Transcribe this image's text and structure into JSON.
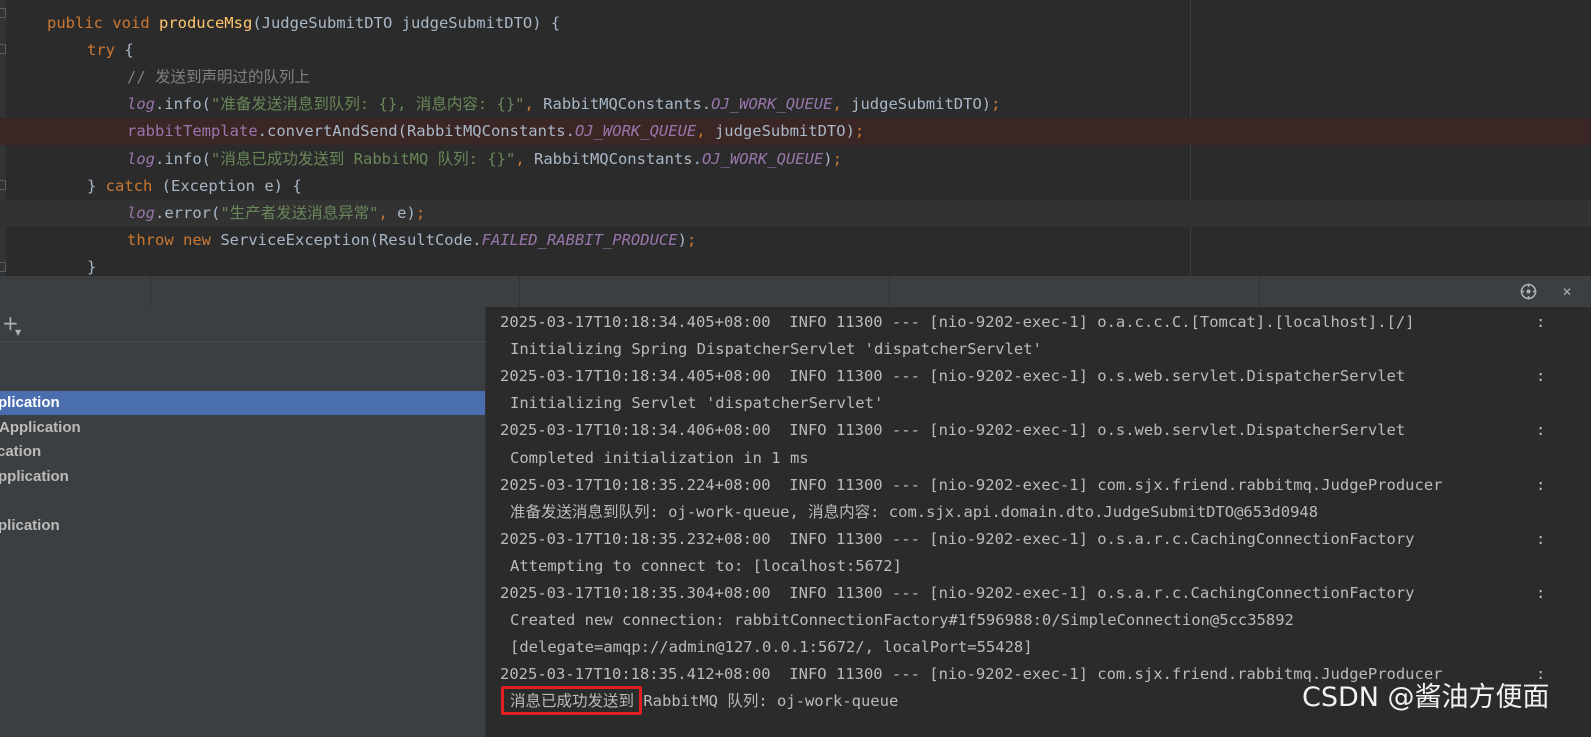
{
  "editor": {
    "lines": [
      [
        {
          "c": "kw",
          "t": "public void "
        },
        {
          "c": "fn",
          "t": "produceMsg"
        },
        {
          "c": "",
          "t": "(JudgeSubmitDTO judgeSubmitDTO) {"
        }
      ],
      [
        {
          "c": "kw",
          "t": "try "
        },
        {
          "c": "",
          "t": "{"
        }
      ],
      [
        {
          "c": "cm",
          "t": "// 发送到声明过的队列上"
        }
      ],
      [
        {
          "c": "sf",
          "t": "log"
        },
        {
          "c": "",
          "t": ".info("
        },
        {
          "c": "st",
          "t": "\"准备发送消息到队列: {}, 消息内容: {}\""
        },
        {
          "c": "kw",
          "t": ", "
        },
        {
          "c": "",
          "t": "RabbitMQConstants."
        },
        {
          "c": "sf",
          "t": "OJ_WORK_QUEUE"
        },
        {
          "c": "kw",
          "t": ", "
        },
        {
          "c": "",
          "t": "judgeSubmitDTO)"
        },
        {
          "c": "kw",
          "t": ";"
        }
      ],
      [
        {
          "c": "fd",
          "t": "rabbitTemplate"
        },
        {
          "c": "",
          "t": ".convertAndSend(RabbitMQConstants."
        },
        {
          "c": "sf",
          "t": "OJ_WORK_QUEUE"
        },
        {
          "c": "kw",
          "t": ", "
        },
        {
          "c": "",
          "t": "judgeSubmitDTO)"
        },
        {
          "c": "kw",
          "t": ";"
        }
      ],
      [
        {
          "c": "sf",
          "t": "log"
        },
        {
          "c": "",
          "t": ".info("
        },
        {
          "c": "st",
          "t": "\"消息已成功发送到 RabbitMQ 队列: {}\""
        },
        {
          "c": "kw",
          "t": ", "
        },
        {
          "c": "",
          "t": "RabbitMQConstants."
        },
        {
          "c": "sf",
          "t": "OJ_WORK_QUEUE"
        },
        {
          "c": "",
          "t": ")"
        },
        {
          "c": "kw",
          "t": ";"
        }
      ],
      [
        {
          "c": "",
          "t": "} "
        },
        {
          "c": "kw",
          "t": "catch "
        },
        {
          "c": "",
          "t": "(Exception e) {"
        }
      ],
      [
        {
          "c": "sf",
          "t": "log"
        },
        {
          "c": "",
          "t": ".error("
        },
        {
          "c": "st",
          "t": "\"生产者发送消息异常\""
        },
        {
          "c": "kw",
          "t": ", "
        },
        {
          "c": "",
          "t": "e)"
        },
        {
          "c": "kw",
          "t": ";"
        }
      ],
      [
        {
          "c": "kw",
          "t": "throw new "
        },
        {
          "c": "",
          "t": "ServiceException(ResultCode."
        },
        {
          "c": "sf",
          "t": "FAILED_RABBIT_PRODUCE"
        },
        {
          "c": "",
          "t": ")"
        },
        {
          "c": "kw",
          "t": ";"
        }
      ],
      [
        {
          "c": "",
          "t": "}"
        }
      ]
    ]
  },
  "services": {
    "add_label": "+",
    "items": [
      {
        "label": "plication"
      },
      {
        "label": "Application"
      },
      {
        "label": "cation"
      },
      {
        "label": "pplication"
      },
      {
        "label": "plication"
      }
    ]
  },
  "console": {
    "log_lines": [
      {
        "text": "2025-03-17T10:18:34.405+08:00  INFO 11300 --- [nio-9202-exec-1] o.a.c.c.C.[Tomcat].[localhost].[/]",
        "colon": ":"
      },
      {
        "text": "Initializing Spring DispatcherServlet 'dispatcherServlet'",
        "colon": ""
      },
      {
        "text": "2025-03-17T10:18:34.405+08:00  INFO 11300 --- [nio-9202-exec-1] o.s.web.servlet.DispatcherServlet",
        "colon": ":"
      },
      {
        "text": "Initializing Servlet 'dispatcherServlet'",
        "colon": ""
      },
      {
        "text": "2025-03-17T10:18:34.406+08:00  INFO 11300 --- [nio-9202-exec-1] o.s.web.servlet.DispatcherServlet",
        "colon": ":"
      },
      {
        "text": "Completed initialization in 1 ms",
        "colon": ""
      },
      {
        "text": "2025-03-17T10:18:35.224+08:00  INFO 11300 --- [nio-9202-exec-1] com.sjx.friend.rabbitmq.JudgeProducer",
        "colon": ":"
      },
      {
        "text": "准备发送消息到队列: oj-work-queue, 消息内容: com.sjx.api.domain.dto.JudgeSubmitDTO@653d0948",
        "colon": ""
      },
      {
        "text": "2025-03-17T10:18:35.232+08:00  INFO 11300 --- [nio-9202-exec-1] o.s.a.r.c.CachingConnectionFactory",
        "colon": ":"
      },
      {
        "text": "Attempting to connect to: [localhost:5672]",
        "colon": ""
      },
      {
        "text": "2025-03-17T10:18:35.304+08:00  INFO 11300 --- [nio-9202-exec-1] o.s.a.r.c.CachingConnectionFactory",
        "colon": ":"
      },
      {
        "text": "Created new connection: rabbitConnectionFactory#1f596988:0/SimpleConnection@5cc35892",
        "colon": ""
      },
      {
        "text": "[delegate=amqp://admin@127.0.0.1:5672/, localPort=55428]",
        "colon": ""
      },
      {
        "text": "2025-03-17T10:18:35.412+08:00  INFO 11300 --- [nio-9202-exec-1] com.sjx.friend.rabbitmq.JudgeProducer",
        "colon": ":"
      },
      {
        "text": "消息已成功发送到 RabbitMQ 队列: oj-work-queue",
        "colon": ""
      }
    ]
  },
  "watermark": "CSDN @酱油方便面",
  "colors": {
    "selection": "#4b6eaf",
    "highlight_box": "#e02020",
    "error_line_bg": "#3b2626"
  }
}
